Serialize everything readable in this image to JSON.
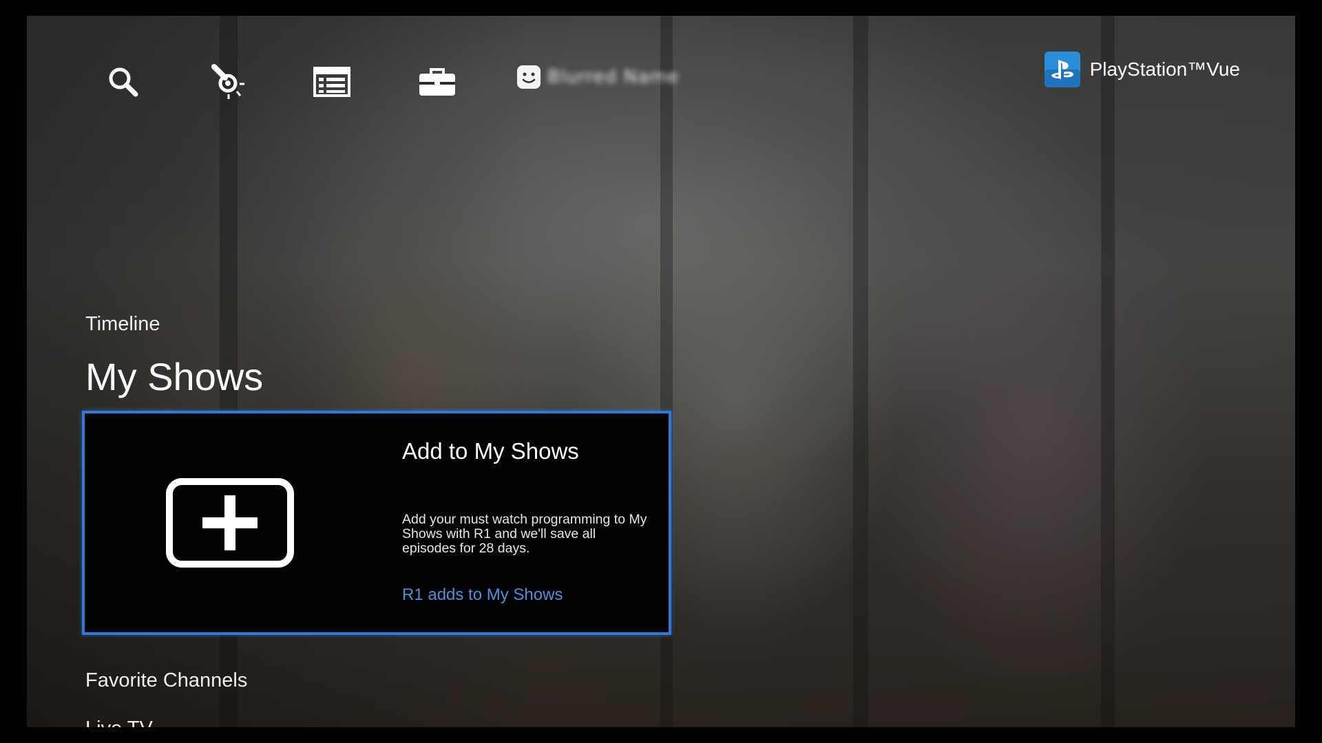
{
  "header": {
    "icons": [
      {
        "name": "search-icon"
      },
      {
        "name": "whats-hot-icon"
      },
      {
        "name": "guide-icon"
      },
      {
        "name": "settings-toolbox-icon"
      }
    ],
    "profile": {
      "icon": "profile-face-icon",
      "name": "Blurred Name"
    },
    "brand": {
      "logo": "playstation-logo-icon",
      "name": "PlayStation™Vue"
    }
  },
  "main": {
    "timeline_label": "Timeline",
    "section_title": "My Shows",
    "card": {
      "title": "Add to My Shows",
      "description": "Add your must watch programming to My Shows with R1 and we'll save all episodes for 28 days.",
      "hint": "R1 adds to My Shows",
      "icon": "add-plus-icon"
    },
    "favorite_channels_label": "Favorite Channels",
    "live_tv_label": "Live TV"
  },
  "colors": {
    "focus_border": "#2f7ad6",
    "hint_text": "#4f8fd6",
    "ps_logo": "#2a8ed8"
  }
}
